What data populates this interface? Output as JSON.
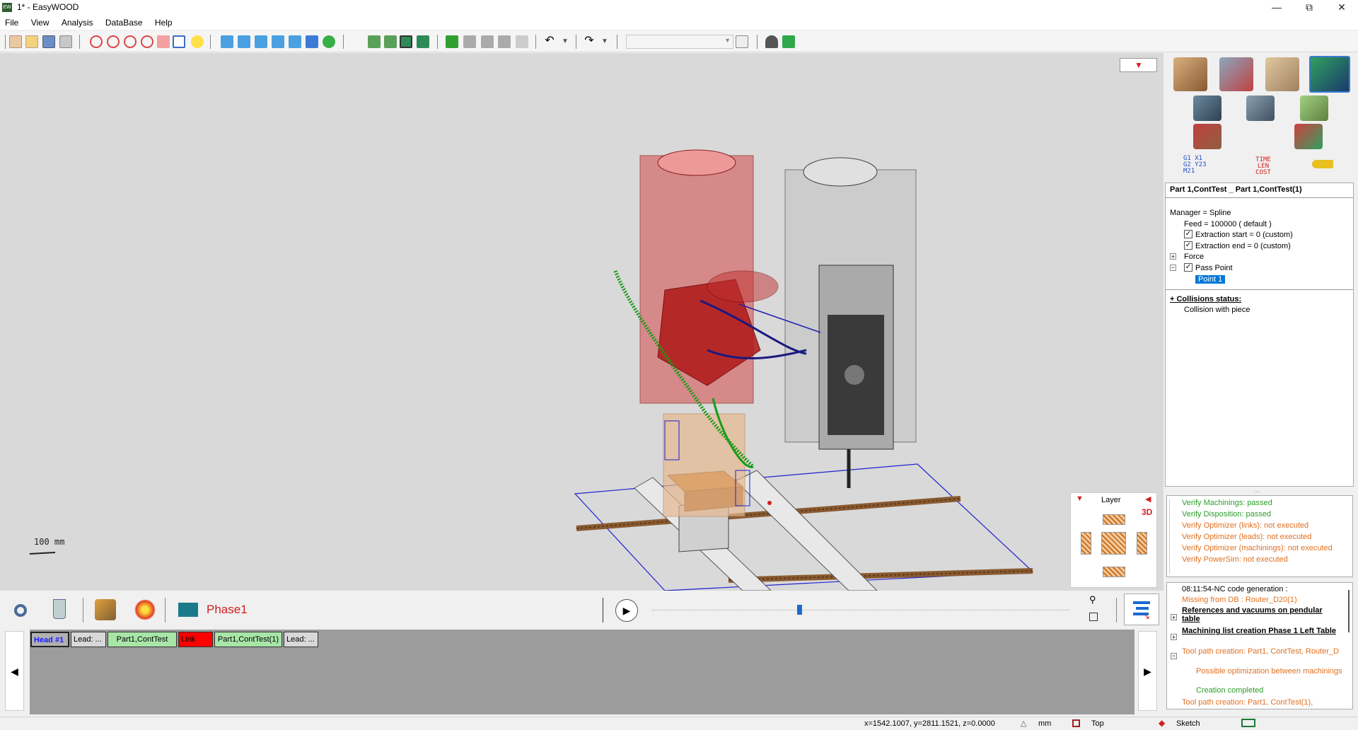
{
  "window": {
    "title": "1* - EasyWOOD",
    "app_icon": "EW"
  },
  "menu": [
    "File",
    "View",
    "Analysis",
    "DataBase",
    "Help"
  ],
  "viewport": {
    "scale_label": "100 mm",
    "layer_panel": {
      "title": "Layer",
      "mode": "3D"
    }
  },
  "properties": {
    "header": "Part 1,ContTest _ Part 1,ContTest(1)",
    "manager": "Manager = Spline",
    "feed": "Feed = 100000 ( default )",
    "extraction_start": "Extraction start = 0 (custom)",
    "extraction_end": "Extraction end = 0 (custom)",
    "force": "Force",
    "pass_point": "Pass Point",
    "point_1": "Point 1",
    "collisions_title": "+ Collisions status:",
    "collision_item": "Collision with piece"
  },
  "right_icons": {
    "row4_left_text": "G1 X1\nG2 Y23\nM21",
    "row4_mid_text": "TIME\nLEN\nCOST"
  },
  "verify": [
    {
      "text": "Verify Machinings: passed",
      "color": "#2a9d2a"
    },
    {
      "text": "Verify Disposition: passed",
      "color": "#2a9d2a"
    },
    {
      "text": "Verify Optimizer (links): not executed",
      "color": "#e07020"
    },
    {
      "text": "Verify Optimizer (leads): not executed",
      "color": "#e07020"
    },
    {
      "text": "Verify Optimizer (machinings): not executed",
      "color": "#e07020"
    },
    {
      "text": "Verify PowerSim: not executed",
      "color": "#e07020"
    }
  ],
  "log": {
    "line1": "08:11:54-NC code generation :",
    "line2": "Missing from DB : Router_D20(1)",
    "line3": "References and vacuums on pendular table",
    "line4": "Machining list creation Phase 1 Left Table",
    "line5": "Tool path creation: Part1, ContTest, Router_D",
    "line6": "Possible optimization between machinings",
    "line7": "Creation completed",
    "line8": "Tool path creation: Part1, ContTest(1),"
  },
  "bottom": {
    "phase": "Phase1"
  },
  "timeline": {
    "chips": [
      {
        "label": "Head #1",
        "bg": "#b0b0b0",
        "fg": "#1a1aff"
      },
      {
        "label": "Lead: ...",
        "bg": "#d8d8d8",
        "fg": "#000"
      },
      {
        "label": "Part1,ContTest",
        "bg": "#a8e6a8",
        "fg": "#000"
      },
      {
        "label": "Link",
        "bg": "#ff0000",
        "fg": "#000"
      },
      {
        "label": "Part1,ContTest(1)",
        "bg": "#a8e6a8",
        "fg": "#000"
      },
      {
        "label": "Lead: ...",
        "bg": "#d8d8d8",
        "fg": "#000"
      }
    ]
  },
  "status": {
    "coords": "x=1542.1007, y=2811.1521, z=0.0000",
    "units": "mm",
    "view": "Top",
    "mode": "Sketch"
  }
}
